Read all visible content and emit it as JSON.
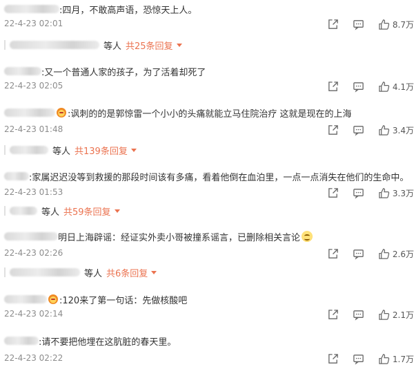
{
  "icon_names": [
    "share-icon",
    "comment-icon",
    "like-icon"
  ],
  "accent_color": "#eb7350",
  "comments": [
    {
      "text": ":四月，不敢高声语，恐惊天上人。",
      "time": "22-4-23 02:01",
      "likes": "8.7万",
      "replies": {
        "who": "等人",
        "more": "共25条回复"
      }
    },
    {
      "text": ":又一个普通人家的孩子，为了活着却死了",
      "time": "22-4-23 02:05",
      "likes": "4.1万"
    },
    {
      "text": ":讽刺的的是郭惊雷一个小小的头痛就能立马住院治疗 这就是现在的上海",
      "time": "22-4-23 01:48",
      "likes": "3.4万",
      "replies": {
        "who": "等人",
        "more": "共139条回复"
      }
    },
    {
      "text": ":家属迟迟没等到救援的那段时间该有多痛，看着他倒在血泊里，一点一点消失在他们的生命中。",
      "time": "22-4-23 01:53",
      "likes": "3.3万",
      "replies": {
        "who": "等人",
        "more": "共59条回复"
      }
    },
    {
      "text": "明日上海辟谣：经证实外卖小哥被撞系谣言，已删除相关言论",
      "time": "22-4-23 02:26",
      "likes": "2.6万",
      "replies": {
        "who": "等人",
        "more": "共6条回复"
      }
    },
    {
      "text": ":120来了第一句话：先做核酸吧",
      "time": "22-4-23 02:14",
      "likes": "2.1万"
    },
    {
      "text": ":请不要把他埋在这肮脏的春天里。",
      "time": "22-4-23 02:22",
      "likes": "1.7万"
    }
  ]
}
